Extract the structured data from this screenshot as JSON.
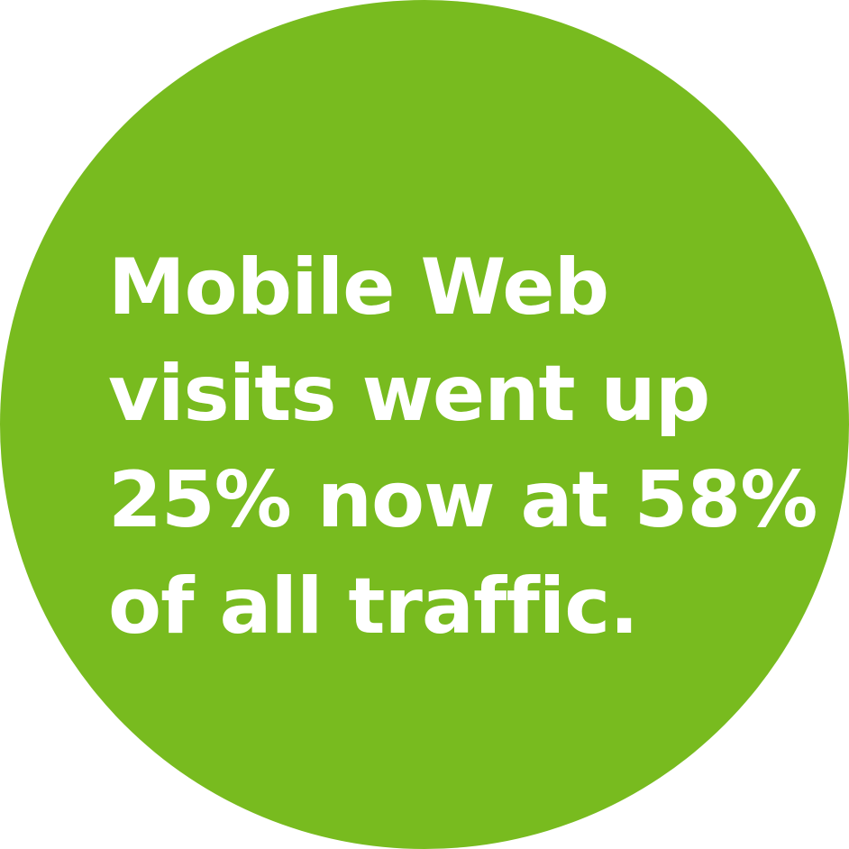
{
  "colors": {
    "circle_fill": "#78bb1f",
    "text": "#ffffff",
    "background": "#ffffff"
  },
  "headline": {
    "lines": [
      "Mobile Web",
      "visits went up",
      "25% now at 58%",
      "of all traffic."
    ]
  }
}
